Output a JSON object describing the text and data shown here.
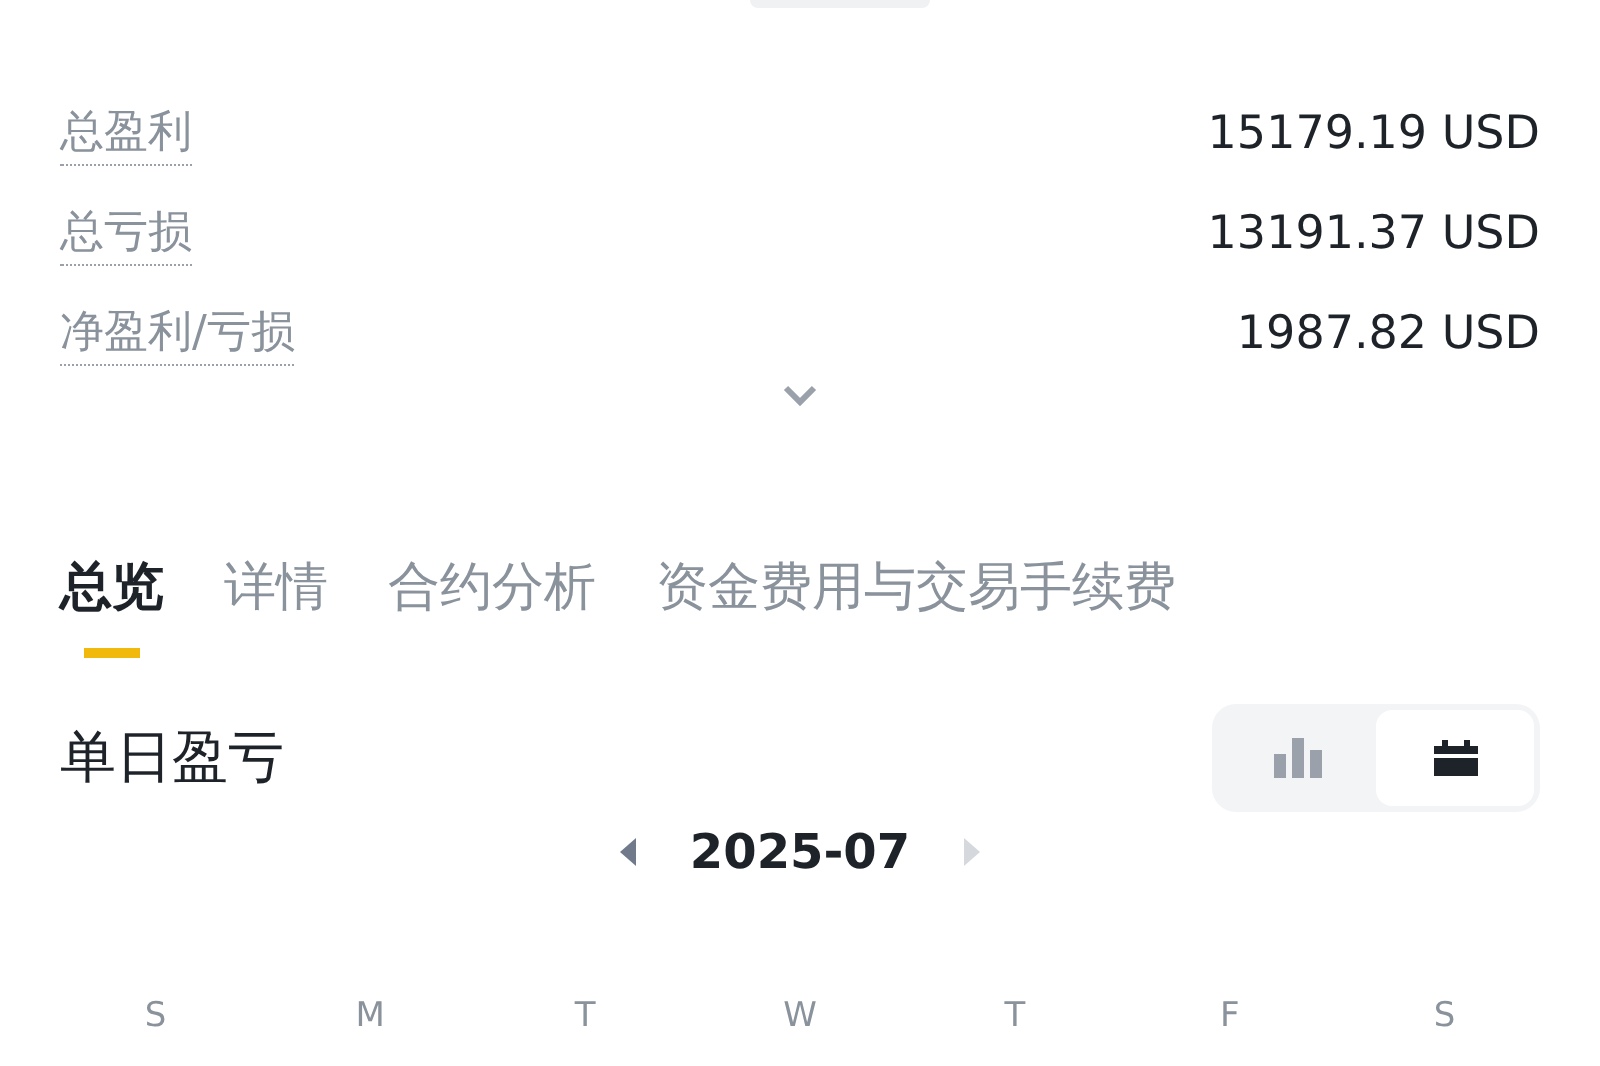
{
  "summary": [
    {
      "label": "总盈利",
      "value": "15179.19 USD"
    },
    {
      "label": "总亏损",
      "value": "13191.37 USD"
    },
    {
      "label": "净盈利/亏损",
      "value": "1987.82 USD"
    }
  ],
  "summary_expanded": false,
  "tabs": [
    {
      "label": "总览",
      "selected": true
    },
    {
      "label": "详情",
      "selected": false
    },
    {
      "label": "合约分析",
      "selected": false
    },
    {
      "label": "资金费用与交易手续费",
      "selected": false
    }
  ],
  "section": {
    "title": "单日盈亏",
    "views": [
      {
        "kind": "bar",
        "selected": false
      },
      {
        "kind": "calendar",
        "selected": true
      }
    ],
    "month": "2025-07",
    "prev_disabled": false,
    "next_disabled": true,
    "weekdays": [
      "S",
      "M",
      "T",
      "W",
      "T",
      "F",
      "S"
    ]
  }
}
